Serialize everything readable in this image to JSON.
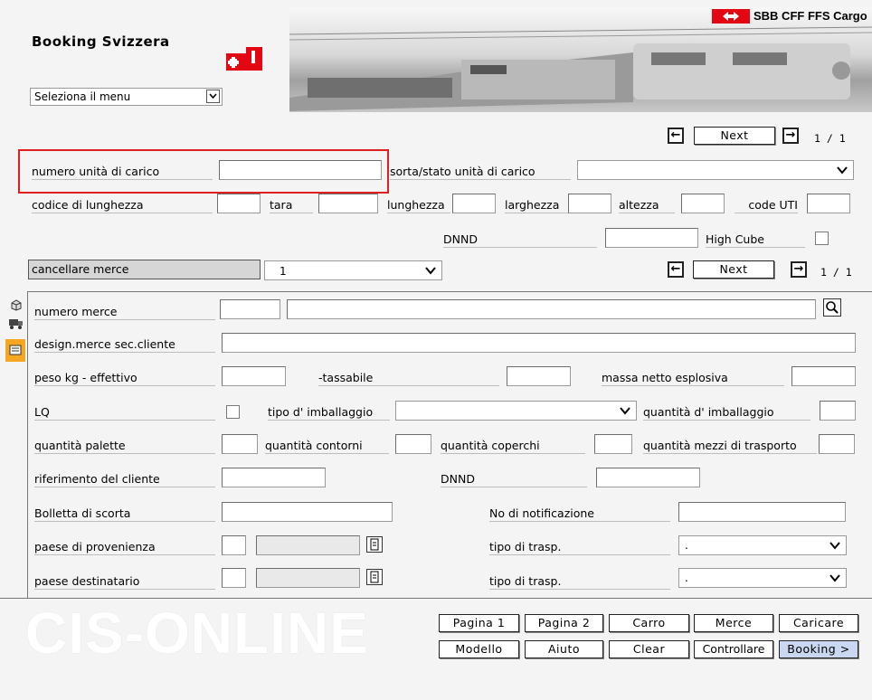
{
  "header": {
    "app_title": "Booking Svizzera",
    "brand": "SBB CFF FFS Cargo",
    "menu_select": "Seleziona il menu"
  },
  "pager_top": {
    "next": "Next",
    "page": "1 / 1"
  },
  "container": {
    "numero_label": "numero unità di carico",
    "sorta_label": "sorta/stato unità di carico",
    "codice_label": "codice di lunghezza",
    "tara_label": "tara",
    "lunghezza_label": "lunghezza",
    "larghezza_label": "larghezza",
    "altezza_label": "altezza",
    "code_uti_label": "code UTI",
    "dnnd_label": "DNND",
    "high_cube_label": "High Cube"
  },
  "goods_bar": {
    "cancel_label": "cancellare merce",
    "select_value": "1",
    "next": "Next",
    "page": "1 / 1"
  },
  "goods": {
    "numero_merce": "numero merce",
    "design": "design.merce sec.cliente",
    "peso": "peso kg - effettivo",
    "tassabile": "-tassabile",
    "massa": "massa netto esplosiva",
    "lq": "LQ",
    "tipo_imb": "tipo d' imballaggio",
    "qta_imb": "quantità d' imballaggio",
    "qta_palette": "quantità palette",
    "qta_contorni": "quantità contorni",
    "qta_coperchi": "quantità coperchi",
    "qta_mezzi": "quantità mezzi di trasporto",
    "riferimento": "riferimento del cliente",
    "dnnd": "DNND",
    "bolletta": "Bolletta di scorta",
    "notificazione": "No di notificazione",
    "paese_prov": "paese di provenienza",
    "tipo_trasp1": "tipo di trasp.",
    "tipo_trasp1_value": ".",
    "paese_dest": "paese destinatario",
    "tipo_trasp2": "tipo di trasp.",
    "tipo_trasp2_value": "."
  },
  "footer": {
    "logo": "CIS-ONLINE",
    "buttons_row1": [
      "Pagina 1",
      "Pagina 2",
      "Carro",
      "Merce",
      "Caricare"
    ],
    "buttons_row2": [
      "Modello",
      "Aiuto",
      "Clear",
      "Controllare",
      "Booking >"
    ]
  },
  "colors": {
    "highlight": "#e02020",
    "active_tab": "#f5a623",
    "booking_button": "#c9d7f0"
  }
}
